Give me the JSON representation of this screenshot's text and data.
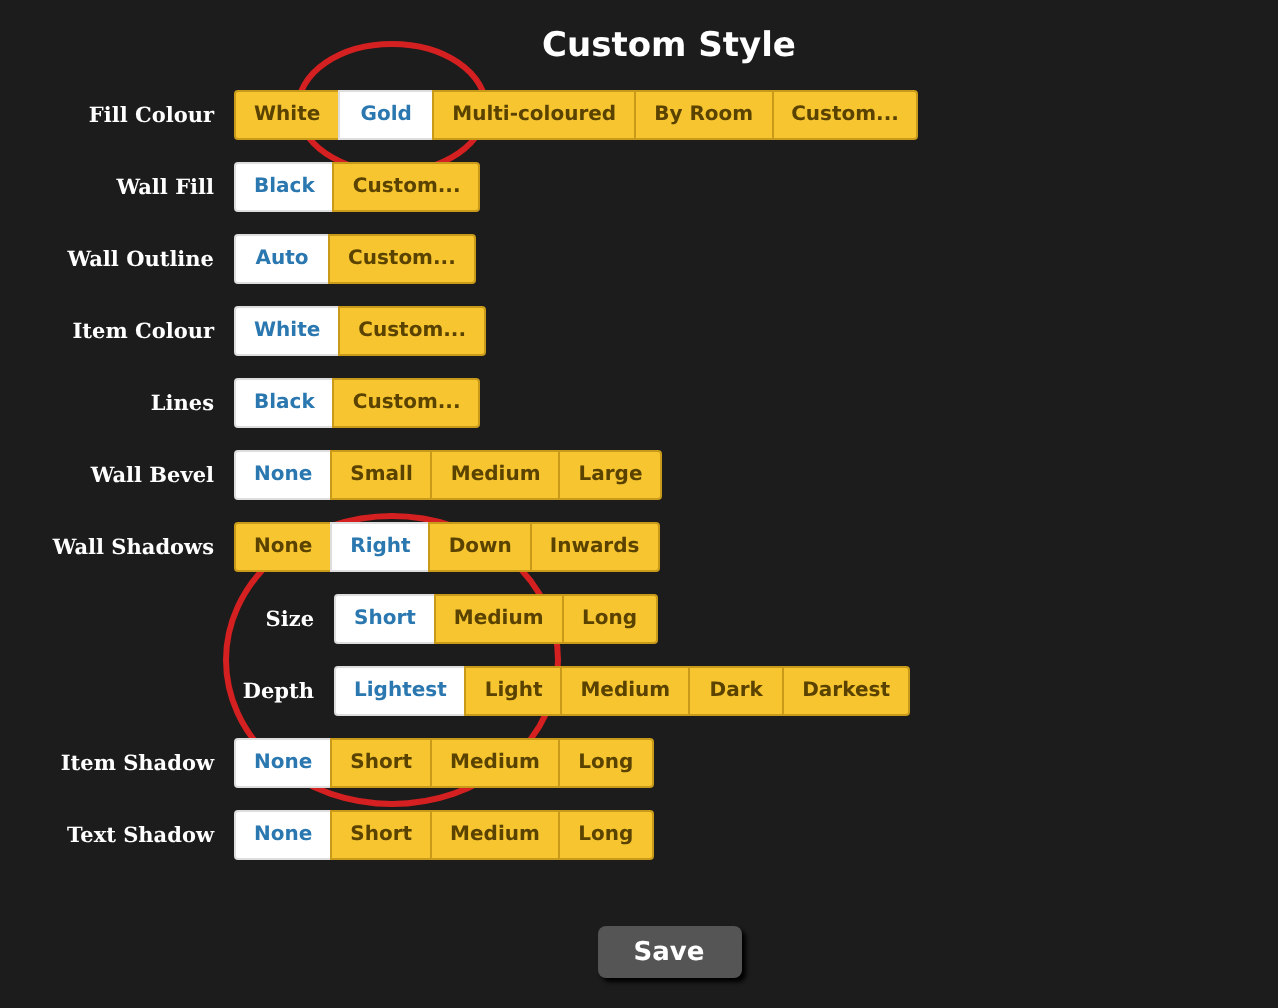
{
  "title": "Custom Style",
  "rows": [
    {
      "kind": "main",
      "label": "Fill Colour",
      "options": [
        {
          "label": "White",
          "selected": false
        },
        {
          "label": "Gold",
          "selected": true
        },
        {
          "label": "Multi-coloured",
          "selected": false
        },
        {
          "label": "By Room",
          "selected": false
        },
        {
          "label": "Custom...",
          "selected": false
        }
      ]
    },
    {
      "kind": "main",
      "label": "Wall Fill",
      "options": [
        {
          "label": "Black",
          "selected": true
        },
        {
          "label": "Custom...",
          "selected": false
        }
      ]
    },
    {
      "kind": "main",
      "label": "Wall Outline",
      "options": [
        {
          "label": "Auto",
          "selected": true
        },
        {
          "label": "Custom...",
          "selected": false
        }
      ]
    },
    {
      "kind": "main",
      "label": "Item Colour",
      "options": [
        {
          "label": "White",
          "selected": true
        },
        {
          "label": "Custom...",
          "selected": false
        }
      ]
    },
    {
      "kind": "main",
      "label": "Lines",
      "options": [
        {
          "label": "Black",
          "selected": true
        },
        {
          "label": "Custom...",
          "selected": false
        }
      ]
    },
    {
      "kind": "main",
      "label": "Wall Bevel",
      "options": [
        {
          "label": "None",
          "selected": true
        },
        {
          "label": "Small",
          "selected": false
        },
        {
          "label": "Medium",
          "selected": false
        },
        {
          "label": "Large",
          "selected": false
        }
      ]
    },
    {
      "kind": "main",
      "label": "Wall Shadows",
      "options": [
        {
          "label": "None",
          "selected": false
        },
        {
          "label": "Right",
          "selected": true
        },
        {
          "label": "Down",
          "selected": false
        },
        {
          "label": "Inwards",
          "selected": false
        }
      ]
    },
    {
      "kind": "sub",
      "label": "Size",
      "options": [
        {
          "label": "Short",
          "selected": true
        },
        {
          "label": "Medium",
          "selected": false
        },
        {
          "label": "Long",
          "selected": false
        }
      ]
    },
    {
      "kind": "sub",
      "label": "Depth",
      "options": [
        {
          "label": "Lightest",
          "selected": true
        },
        {
          "label": "Light",
          "selected": false
        },
        {
          "label": "Medium",
          "selected": false
        },
        {
          "label": "Dark",
          "selected": false
        },
        {
          "label": "Darkest",
          "selected": false
        }
      ]
    },
    {
      "kind": "main",
      "label": "Item Shadow",
      "options": [
        {
          "label": "None",
          "selected": true
        },
        {
          "label": "Short",
          "selected": false
        },
        {
          "label": "Medium",
          "selected": false
        },
        {
          "label": "Long",
          "selected": false
        }
      ]
    },
    {
      "kind": "main",
      "label": "Text Shadow",
      "options": [
        {
          "label": "None",
          "selected": true
        },
        {
          "label": "Short",
          "selected": false
        },
        {
          "label": "Medium",
          "selected": false
        },
        {
          "label": "Long",
          "selected": false
        }
      ]
    }
  ],
  "save_button": "Save"
}
